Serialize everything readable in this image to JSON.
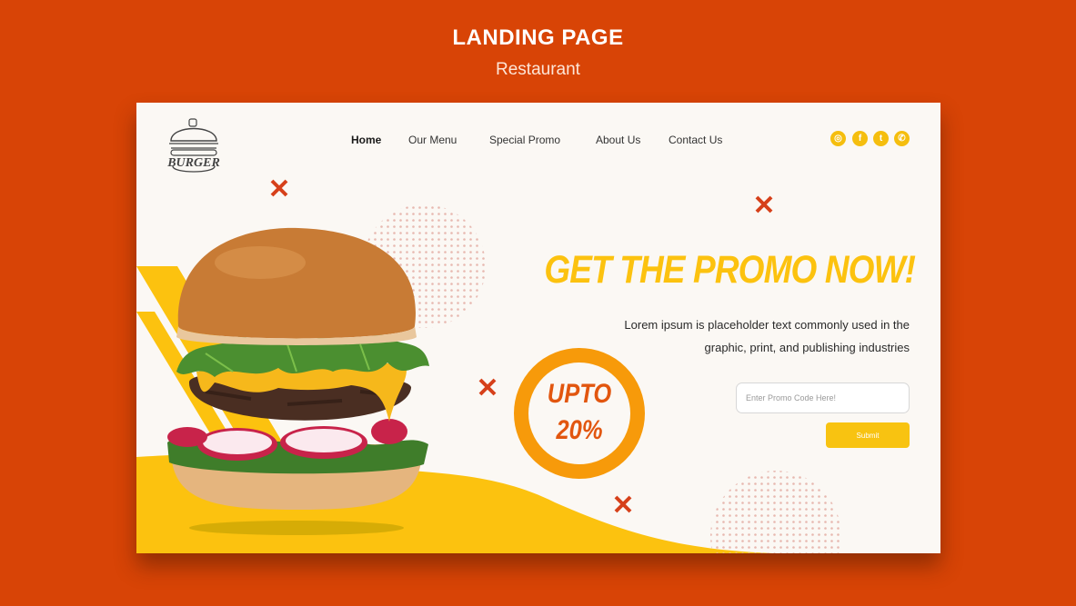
{
  "header": {
    "title": "LANDING PAGE",
    "subtitle": "Restaurant"
  },
  "logo": {
    "text": "BURGER"
  },
  "nav": {
    "items": [
      {
        "label": "Home",
        "active": true
      },
      {
        "label": "Our Menu",
        "active": false
      },
      {
        "label": "Special Promo",
        "active": false
      },
      {
        "label": "About Us",
        "active": false
      },
      {
        "label": "Contact Us",
        "active": false
      }
    ]
  },
  "socials": [
    {
      "icon": "instagram-icon",
      "glyph": "◎"
    },
    {
      "icon": "facebook-icon",
      "glyph": "f"
    },
    {
      "icon": "twitter-icon",
      "glyph": "t"
    },
    {
      "icon": "whatsapp-icon",
      "glyph": "✆"
    }
  ],
  "hero": {
    "headline": "GET THE PROMO NOW!",
    "description": "Lorem ipsum is placeholder text commonly used in the graphic, print, and publishing industries",
    "promo_line1": "UPTO",
    "promo_line2": "20%"
  },
  "promo_form": {
    "placeholder": "Enter Promo Code Here!",
    "value": "",
    "submit_label": "Submit"
  },
  "colors": {
    "background": "#d84406",
    "accent_yellow": "#fcc20f",
    "accent_orange": "#f79a0a",
    "cross_red": "#d6401a",
    "canvas": "#fbf8f4"
  }
}
